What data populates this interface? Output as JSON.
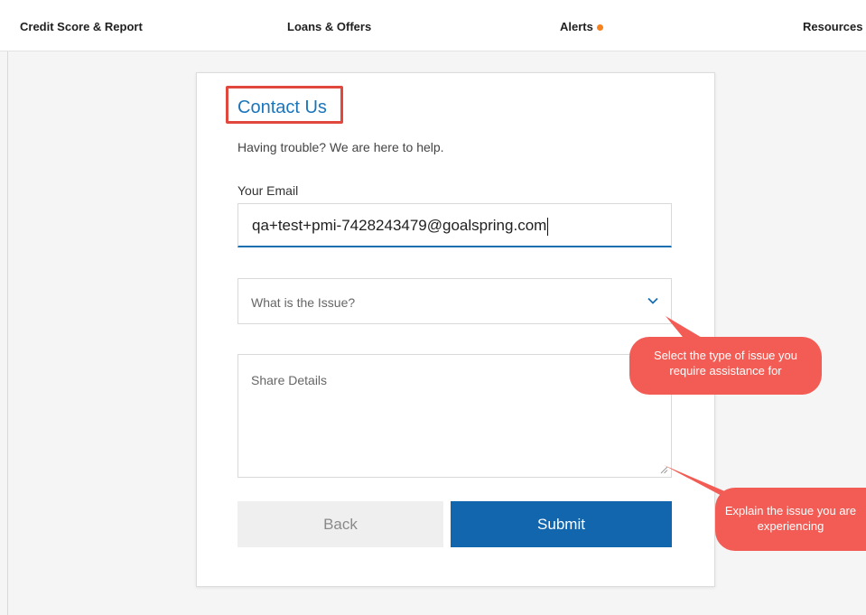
{
  "nav": {
    "items": [
      {
        "label": "Credit Score & Report"
      },
      {
        "label": "Loans & Offers"
      },
      {
        "label": "Alerts"
      },
      {
        "label": "Resources"
      }
    ],
    "alert_dot_color": "#f5821f"
  },
  "form": {
    "title": "Contact Us",
    "subtitle": "Having trouble? We are here to help.",
    "email_label": "Your Email",
    "email_value": "qa+test+pmi-7428243479@goalspring.com",
    "issue_placeholder": "What is the Issue?",
    "details_placeholder": "Share Details",
    "back_label": "Back",
    "submit_label": "Submit"
  },
  "annotations": {
    "issue_callout": "Select the type of issue you require assistance for",
    "details_callout": "Explain the issue you are experiencing",
    "highlight_color": "#e0473d",
    "callout_color": "#f25c54"
  },
  "colors": {
    "accent": "#1a75bb",
    "submit": "#1166ad"
  },
  "icons": {
    "dropdown": "chevron-down-icon",
    "resize": "resize-grip-icon"
  }
}
